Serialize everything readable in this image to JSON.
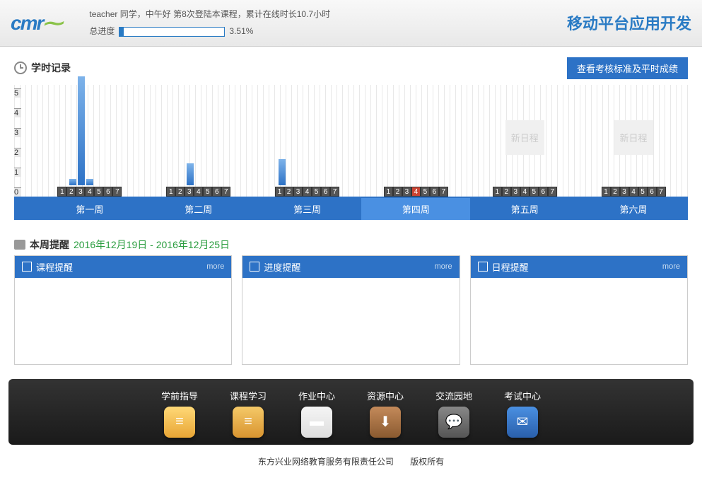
{
  "header": {
    "logo_text": "cmr",
    "greeting": "teacher 同学，中午好  第8次登陆本课程，累计在线时长10.7小时",
    "progress_label": "总进度",
    "progress_pct": "3.51%",
    "course_title": "移动平台应用开发"
  },
  "chart_section": {
    "title": "学时记录",
    "button": "查看考核标准及平时成绩"
  },
  "chart_data": {
    "type": "bar",
    "ylabel": "",
    "ylim": [
      0,
      5
    ],
    "y_ticks": [
      0,
      1,
      2,
      3,
      4,
      5
    ],
    "current_week": 4,
    "current_day": 4,
    "weeks": [
      {
        "name": "第一周",
        "days": [
          0,
          0.3,
          5.5,
          0.3,
          0,
          0,
          0
        ]
      },
      {
        "name": "第二周",
        "days": [
          0,
          0,
          1.1,
          0,
          0,
          0,
          0
        ]
      },
      {
        "name": "第三周",
        "days": [
          1.3,
          0,
          0,
          0,
          0,
          0,
          0
        ]
      },
      {
        "name": "第四周",
        "days": [
          0,
          0,
          0,
          0,
          0,
          0,
          0
        ]
      },
      {
        "name": "第五周",
        "days": [
          0,
          0,
          0,
          0,
          0,
          0,
          0
        ],
        "placeholder": "新日程"
      },
      {
        "name": "第六周",
        "days": [
          0,
          0,
          0,
          0,
          0,
          0,
          0
        ],
        "placeholder": "新日程"
      }
    ]
  },
  "reminders": {
    "title": "本周提醒",
    "date_from": "2016年12月19日",
    "date_sep": " - ",
    "date_to": "2016年12月25日",
    "cards": [
      {
        "title": "课程提醒",
        "more": "more"
      },
      {
        "title": "进度提醒",
        "more": "more"
      },
      {
        "title": "日程提醒",
        "more": "more"
      }
    ]
  },
  "nav": {
    "items": [
      {
        "label": "学前指导",
        "icon_class": "yellow",
        "glyph": "≡"
      },
      {
        "label": "课程学习",
        "icon_class": "orange",
        "glyph": "≡"
      },
      {
        "label": "作业中心",
        "icon_class": "red",
        "glyph": "▬"
      },
      {
        "label": "资源中心",
        "icon_class": "brown",
        "glyph": "⬇"
      },
      {
        "label": "交流园地",
        "icon_class": "gray",
        "glyph": "💬"
      },
      {
        "label": "考试中心",
        "icon_class": "blue",
        "glyph": "✉"
      }
    ]
  },
  "footer": {
    "company": "东方兴业网络教育服务有限责任公司",
    "rights": "版权所有"
  }
}
